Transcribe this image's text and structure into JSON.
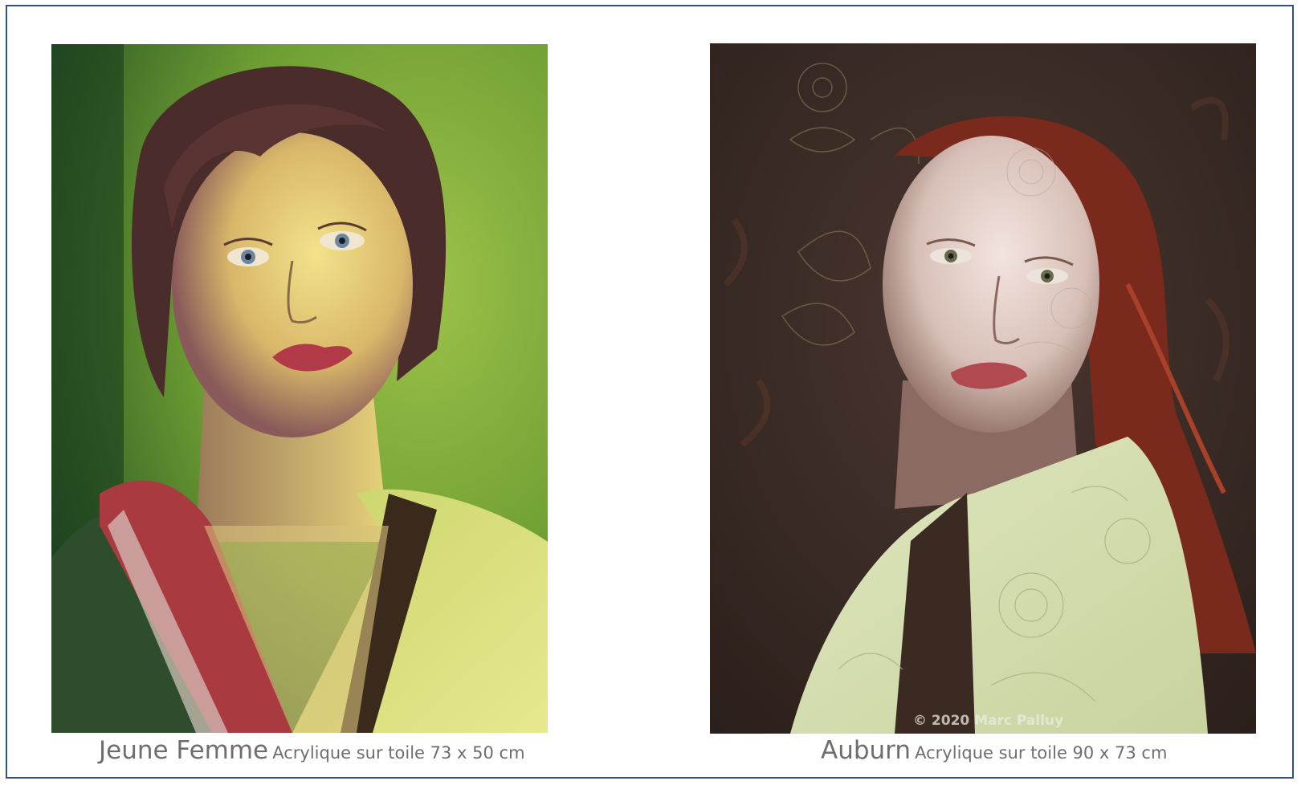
{
  "paintings": [
    {
      "title": "Jeune Femme",
      "medium": "Acrylique sur toile 73 x 50 cm",
      "background_color": "#7fae3a"
    },
    {
      "title": "Auburn",
      "medium": "Acrylique sur toile 90 x 73 cm",
      "watermark": "© 2020 Marc Palluy",
      "background_color": "#3a2a24"
    }
  ],
  "colors": {
    "frame_border": "#2f4f8f",
    "caption_text": "#6e6e6e"
  }
}
